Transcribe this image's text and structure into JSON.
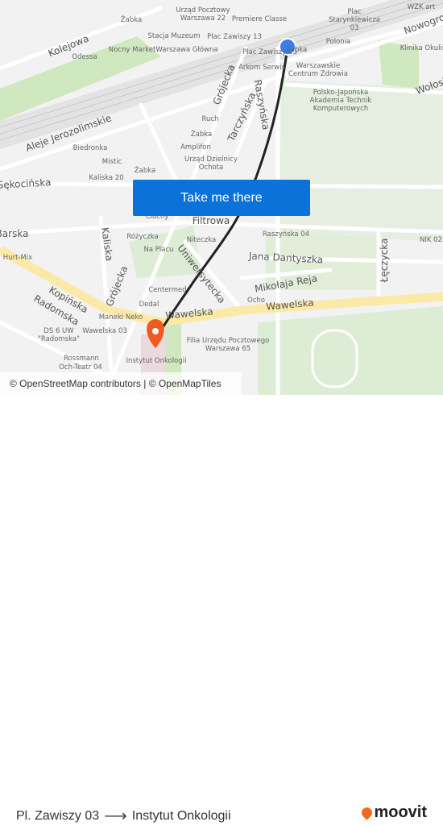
{
  "map": {
    "streets": [
      "Kolejowa",
      "Aleje Jerozolimskie",
      "Grójecka",
      "Tarczyńska",
      "Raszyńska",
      "Sękocińska",
      "Filtrowa",
      "Barska",
      "Kaliska",
      "Grójecka",
      "Uniwersytecka",
      "Jana Dantyszka",
      "Mikołaja Reja",
      "Łęczycka",
      "Kopińska",
      "Radomska",
      "Wawelska",
      "Wawelska",
      "Nowogrodzka",
      "Wołoska"
    ],
    "pois": [
      "Urząd Pocztowy Warszawa 22",
      "Żabka",
      "Premiere Classe",
      "WZK art",
      "Plac Starynkiewicza 03",
      "Stacja Muzeum",
      "Plac Zawiszy 13",
      "Polonia",
      "Klinika Okulis",
      "Nocny Market",
      "Warszawa Główna",
      "Plac Zawiszy 03",
      "Żabka",
      "Odessa",
      "Arkom Serwis",
      "Warszawskie Centrum Zdrowia",
      "Polsko-Japońska Akademia Technik Komputerowych",
      "Ruch",
      "Żabka",
      "Amplifon",
      "Biedronka",
      "Urząd Dzielnicy Ochota",
      "Mistic",
      "Żabka",
      "Kaliska 20",
      "Cluchy",
      "Różyczka",
      "Niteczka",
      "Raszyńska 04",
      "NIK 02",
      "Hurt-Mix",
      "Na Placu",
      "Centermed",
      "Dedal",
      "Ocho",
      "Maneki Neko",
      "DS 6 UW \"Radomska\"",
      "Wawelska 03",
      "Filia Urzędu Pocztowego Warszawa 65",
      "Rossmann",
      "Instytut Onkologii",
      "Och-Teatr 04"
    ],
    "origin_marker_color": "#3d7eea",
    "destination_marker_color": "#f05a1e",
    "route_line_color": "#222222",
    "attribution": "© OpenStreetMap contributors | © OpenMapTiles"
  },
  "cta": {
    "label": "Take me there",
    "color": "#0b72d9"
  },
  "footer": {
    "origin": "Pl. Zawiszy 03",
    "arrow_icon": "arrow-right-icon",
    "destination": "Instytut Onkologii",
    "logo_text": "moovit",
    "logo_color": "#f26b1d"
  }
}
